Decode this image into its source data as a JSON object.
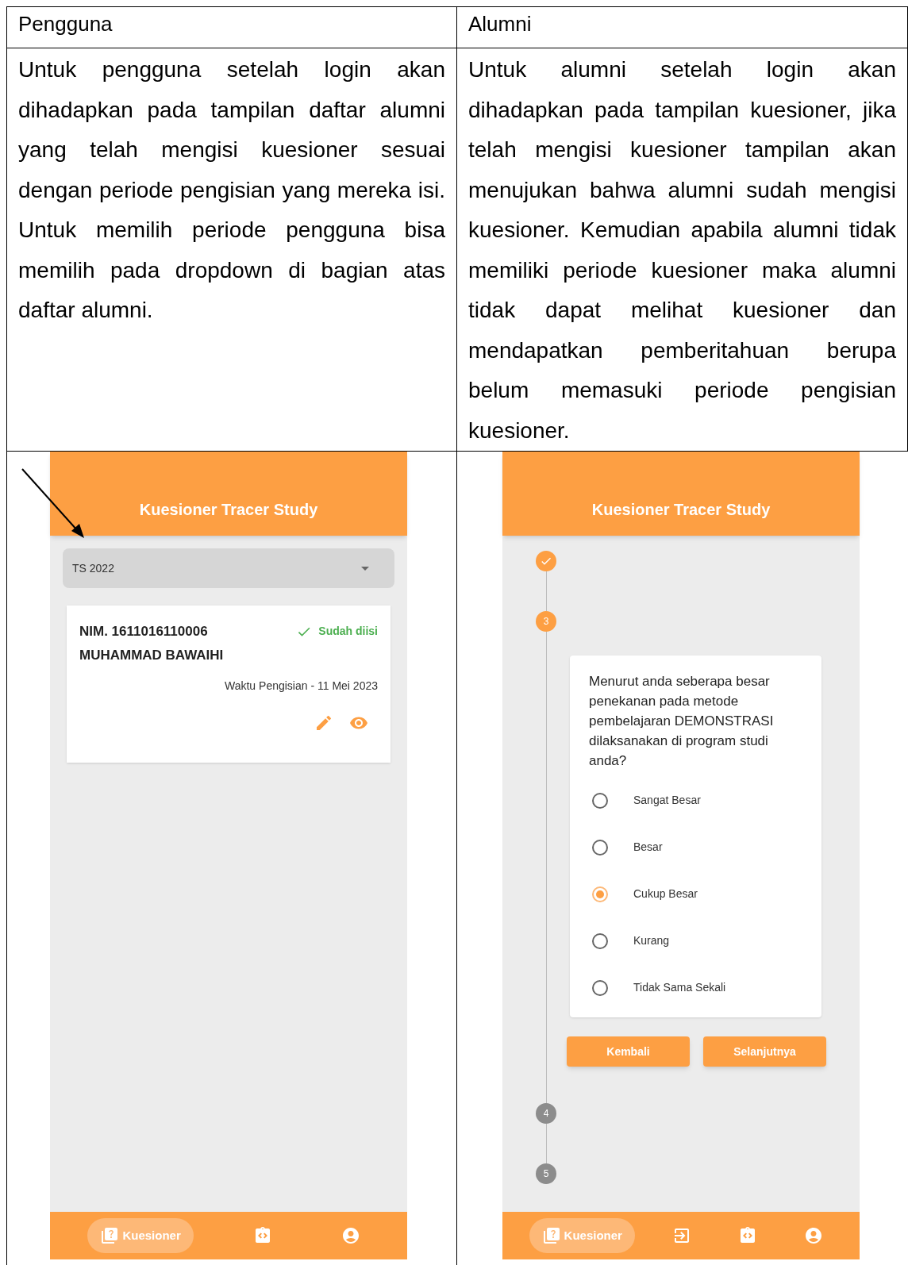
{
  "table": {
    "columns": [
      "Pengguna",
      "Alumni"
    ],
    "descriptions": [
      "Untuk pengguna setelah login akan dihadapkan pada tampilan daftar alumni yang telah mengisi kuesioner sesuai dengan periode pengisian yang mereka isi. Untuk memilih periode pengguna bisa memilih pada dropdown di bagian atas daftar alumni.",
      "Untuk alumni setelah login akan dihadapkan pada tampilan kuesioner, jika telah mengisi kuesioner tampilan akan menujukan bahwa alumni sudah mengisi kuesioner. Kemudian apabila alumni tidak memiliki periode kuesioner maka alumni tidak dapat melihat kuesioner dan mendapatkan pemberitahuan berupa belum memasuki periode pengisian kuesioner."
    ]
  },
  "user_screen": {
    "title": "Kuesioner Tracer Study",
    "period": "TS 2022",
    "card": {
      "nim": "NIM. 1611016110006",
      "name": "MUHAMMAD BAWAIHI",
      "status": "Sudah diisi",
      "completed": true,
      "time": "Waktu Pengisian - 11 Mei 2023"
    },
    "nav": [
      {
        "kind": "quiz",
        "label": "Kuesioner",
        "selected": true
      },
      {
        "kind": "code",
        "selected": false
      },
      {
        "kind": "account",
        "selected": false
      }
    ]
  },
  "alumni_screen": {
    "title": "Kuesioner Tracer Study",
    "steps": [
      {
        "kind": "done"
      },
      {
        "kind": "active",
        "label": "3"
      },
      {
        "kind": "pending",
        "label": "4"
      },
      {
        "kind": "pending",
        "label": "5"
      }
    ],
    "question": "Menurut anda seberapa besar penekanan pada metode pembelajaran DEMONSTRASI dilaksanakan di program studi anda?",
    "options": [
      {
        "label": "Sangat Besar",
        "selected": false
      },
      {
        "label": "Besar",
        "selected": false
      },
      {
        "label": "Cukup Besar",
        "selected": true
      },
      {
        "label": "Kurang",
        "selected": false
      },
      {
        "label": "Tidak Sama Sekali",
        "selected": false
      }
    ],
    "buttons": [
      "Kembali",
      "Selanjutnya"
    ],
    "nav": [
      {
        "kind": "quiz",
        "label": "Kuesioner",
        "selected": true
      },
      {
        "kind": "export",
        "selected": false
      },
      {
        "kind": "code",
        "selected": false
      },
      {
        "kind": "account",
        "selected": false
      }
    ]
  }
}
